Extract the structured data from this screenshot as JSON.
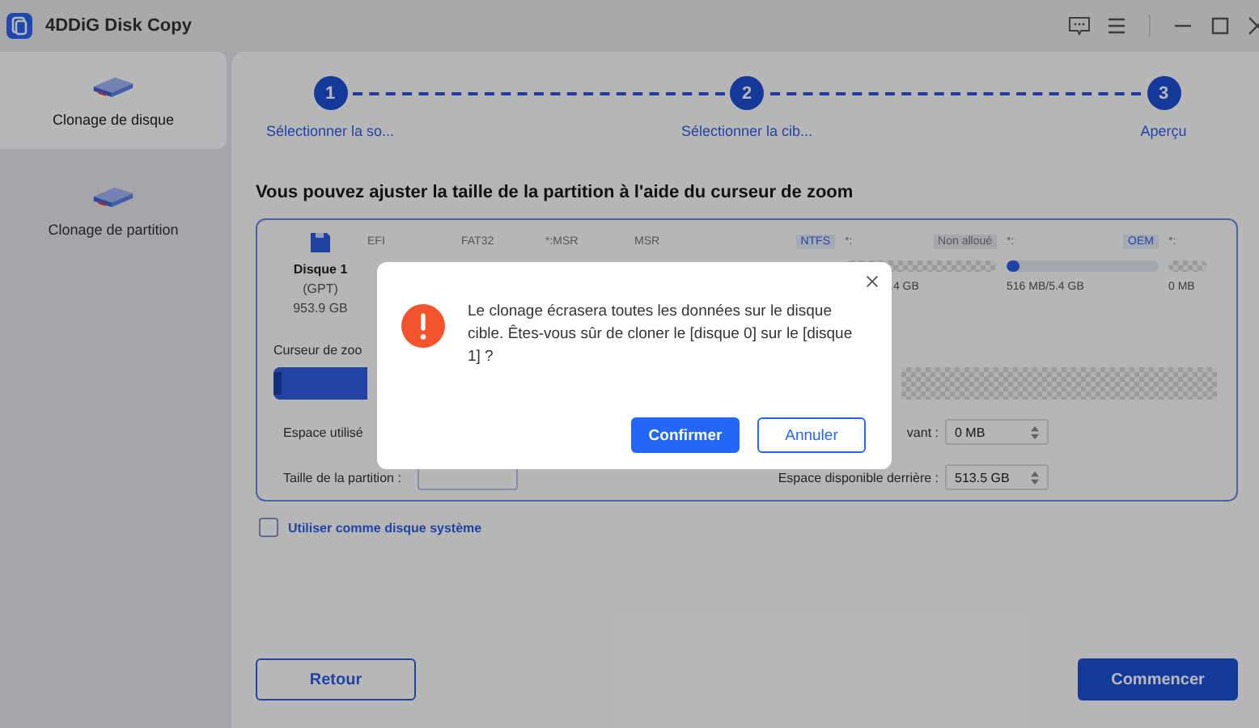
{
  "window": {
    "title": "4DDiG Disk Copy"
  },
  "sidebar": {
    "items": [
      {
        "label": "Clonage de disque",
        "selected": true
      },
      {
        "label": "Clonage de partition",
        "selected": false
      }
    ]
  },
  "steps": [
    {
      "number": "1",
      "label": "Sélectionner la so..."
    },
    {
      "number": "2",
      "label": "Sélectionner la cib..."
    },
    {
      "number": "3",
      "label": "Aperçu"
    }
  ],
  "heading": "Vous pouvez ajuster la taille de la partition à l'aide du curseur de zoom",
  "disk": {
    "name": "Disque 1",
    "scheme": "(GPT)",
    "size": "953.9 GB",
    "partitions": [
      {
        "label": "EFI"
      },
      {
        "label": "FAT32"
      },
      {
        "label": "*:MSR"
      },
      {
        "label": "MSR",
        "tag": "NTFS",
        "kind": "used"
      },
      {
        "label": "*:",
        "tag": "Non alloué",
        "kind": "unallocated",
        "size": ".4 GB"
      },
      {
        "label": "*:",
        "tag": "OEM",
        "kind": "used",
        "level": 0.08,
        "size": "516 MB/5.4 GB"
      },
      {
        "label": "*:",
        "kind": "unallocated",
        "size": "0 MB"
      }
    ],
    "zoom": {
      "label": "Curseur de zoo",
      "level": 0.1
    },
    "rows": [
      {
        "label": "Espace utilisé",
        "kind": "text",
        "right_label": "vant :",
        "value": "0 MB"
      },
      {
        "label": "Taille de la partition :",
        "kind": "select",
        "right_label": "Espace disponible derrière :",
        "value": "513.5 GB"
      }
    ]
  },
  "system_disk": {
    "label": "Utiliser comme disque système",
    "checked": false
  },
  "buttons": {
    "back": "Retour",
    "start": "Commencer"
  },
  "dialog": {
    "message": "Le clonage écrasera toutes les données sur le disque cible. Êtes-vous sûr de cloner le [disque 0] sur le [disque 1] ?",
    "buttons": [
      {
        "label": "Confirmer",
        "kind": "primary"
      },
      {
        "label": "Annuler",
        "kind": "secondary"
      }
    ]
  }
}
